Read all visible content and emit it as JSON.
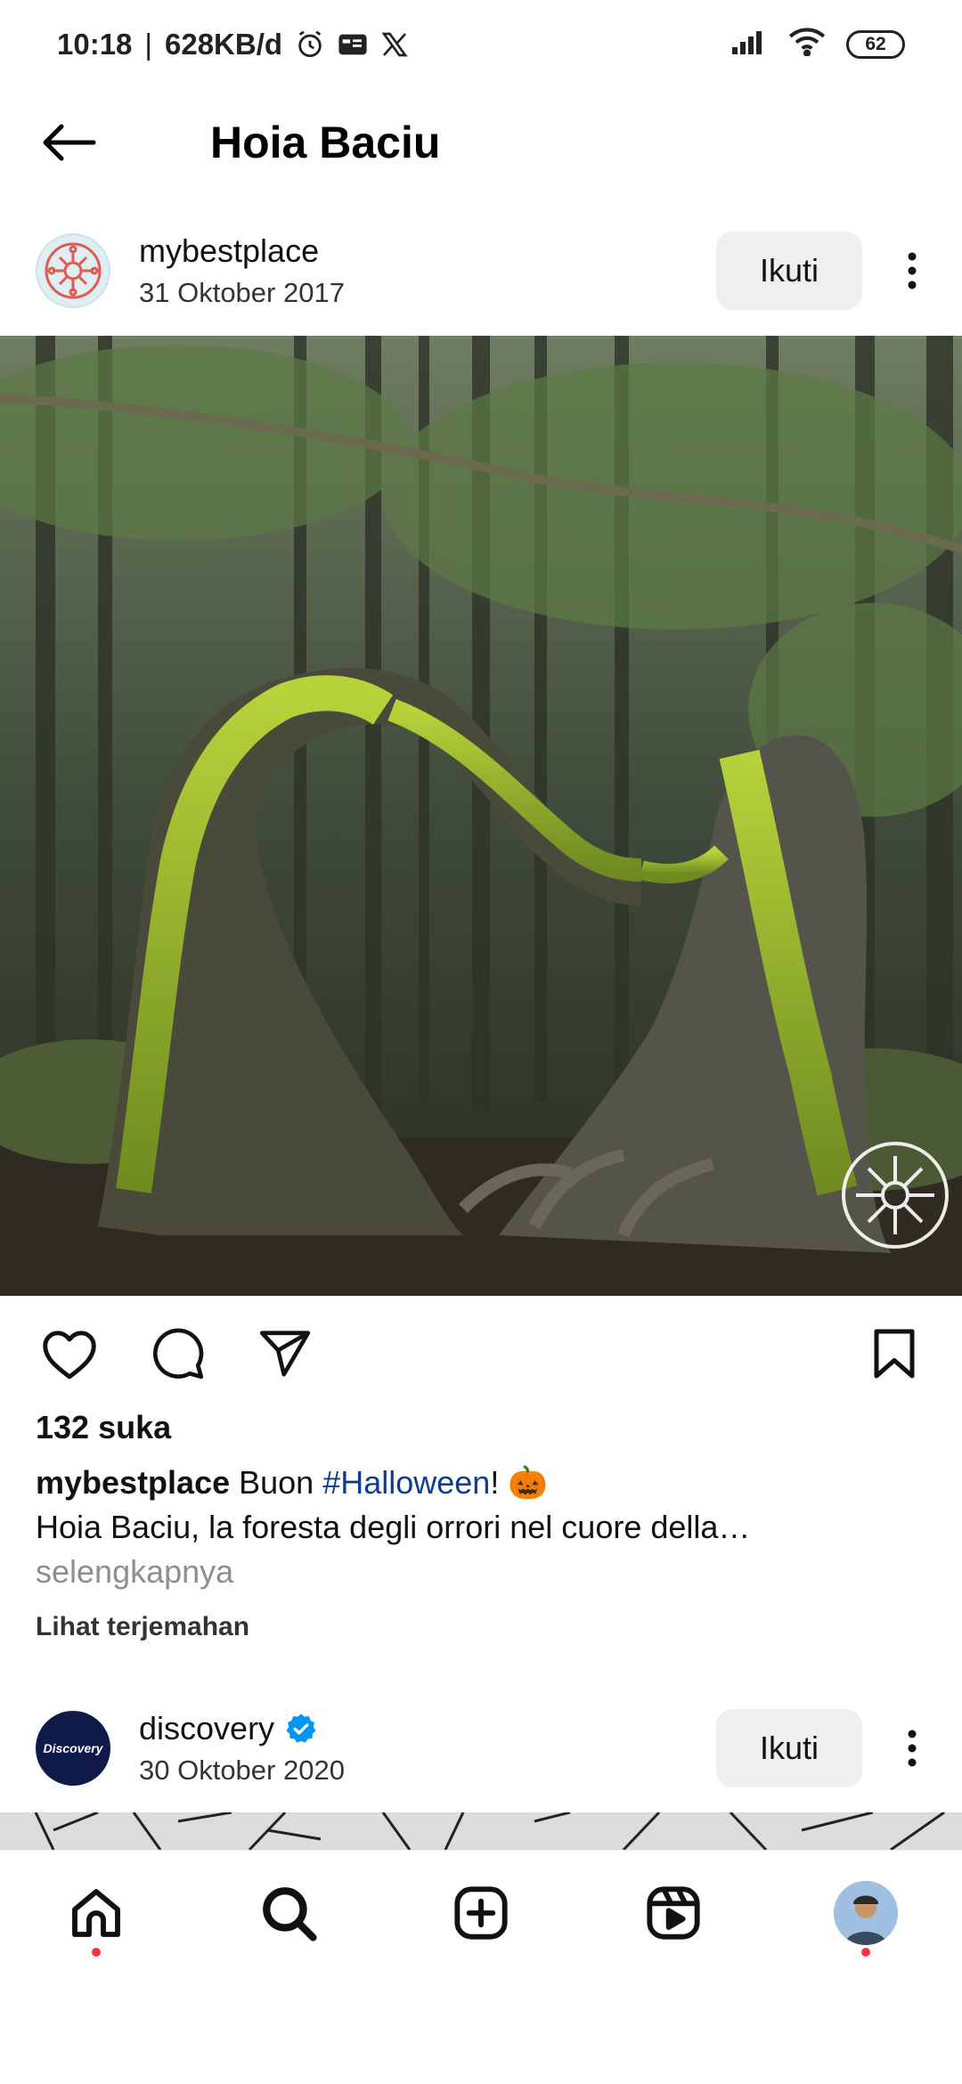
{
  "status_bar": {
    "time": "10:18",
    "net_speed": "628KB/d",
    "battery": "62"
  },
  "app_bar": {
    "title": "Hoia Baciu"
  },
  "post1": {
    "username": "mybestplace",
    "date": "31 Oktober 2017",
    "follow_label": "Ikuti",
    "likes": "132 suka",
    "caption_user": "mybestplace",
    "caption_pre": "Buon ",
    "caption_tag": "#Halloween",
    "caption_post": "! 🎃",
    "caption_line2": "Hoia Baciu, la foresta degli orrori nel cuore della…",
    "more_label": "selengkapnya",
    "translate_label": "Lihat terjemahan"
  },
  "post2": {
    "username": "discovery",
    "date": "30 Oktober 2020",
    "follow_label": "Ikuti",
    "avatar_text": "Discovery"
  },
  "colors": {
    "accent_blue": "#0095f6",
    "hashtag": "#0b3d91",
    "notification_dot": "#ff3040",
    "follow_bg": "#efefef"
  },
  "icons": {
    "back": "arrow-left-icon",
    "like": "heart-icon",
    "comment": "comment-icon",
    "share": "send-icon",
    "save": "bookmark-icon",
    "home": "home-icon",
    "search": "search-icon",
    "create": "plus-square-icon",
    "reels": "reels-icon",
    "profile": "profile-avatar"
  }
}
